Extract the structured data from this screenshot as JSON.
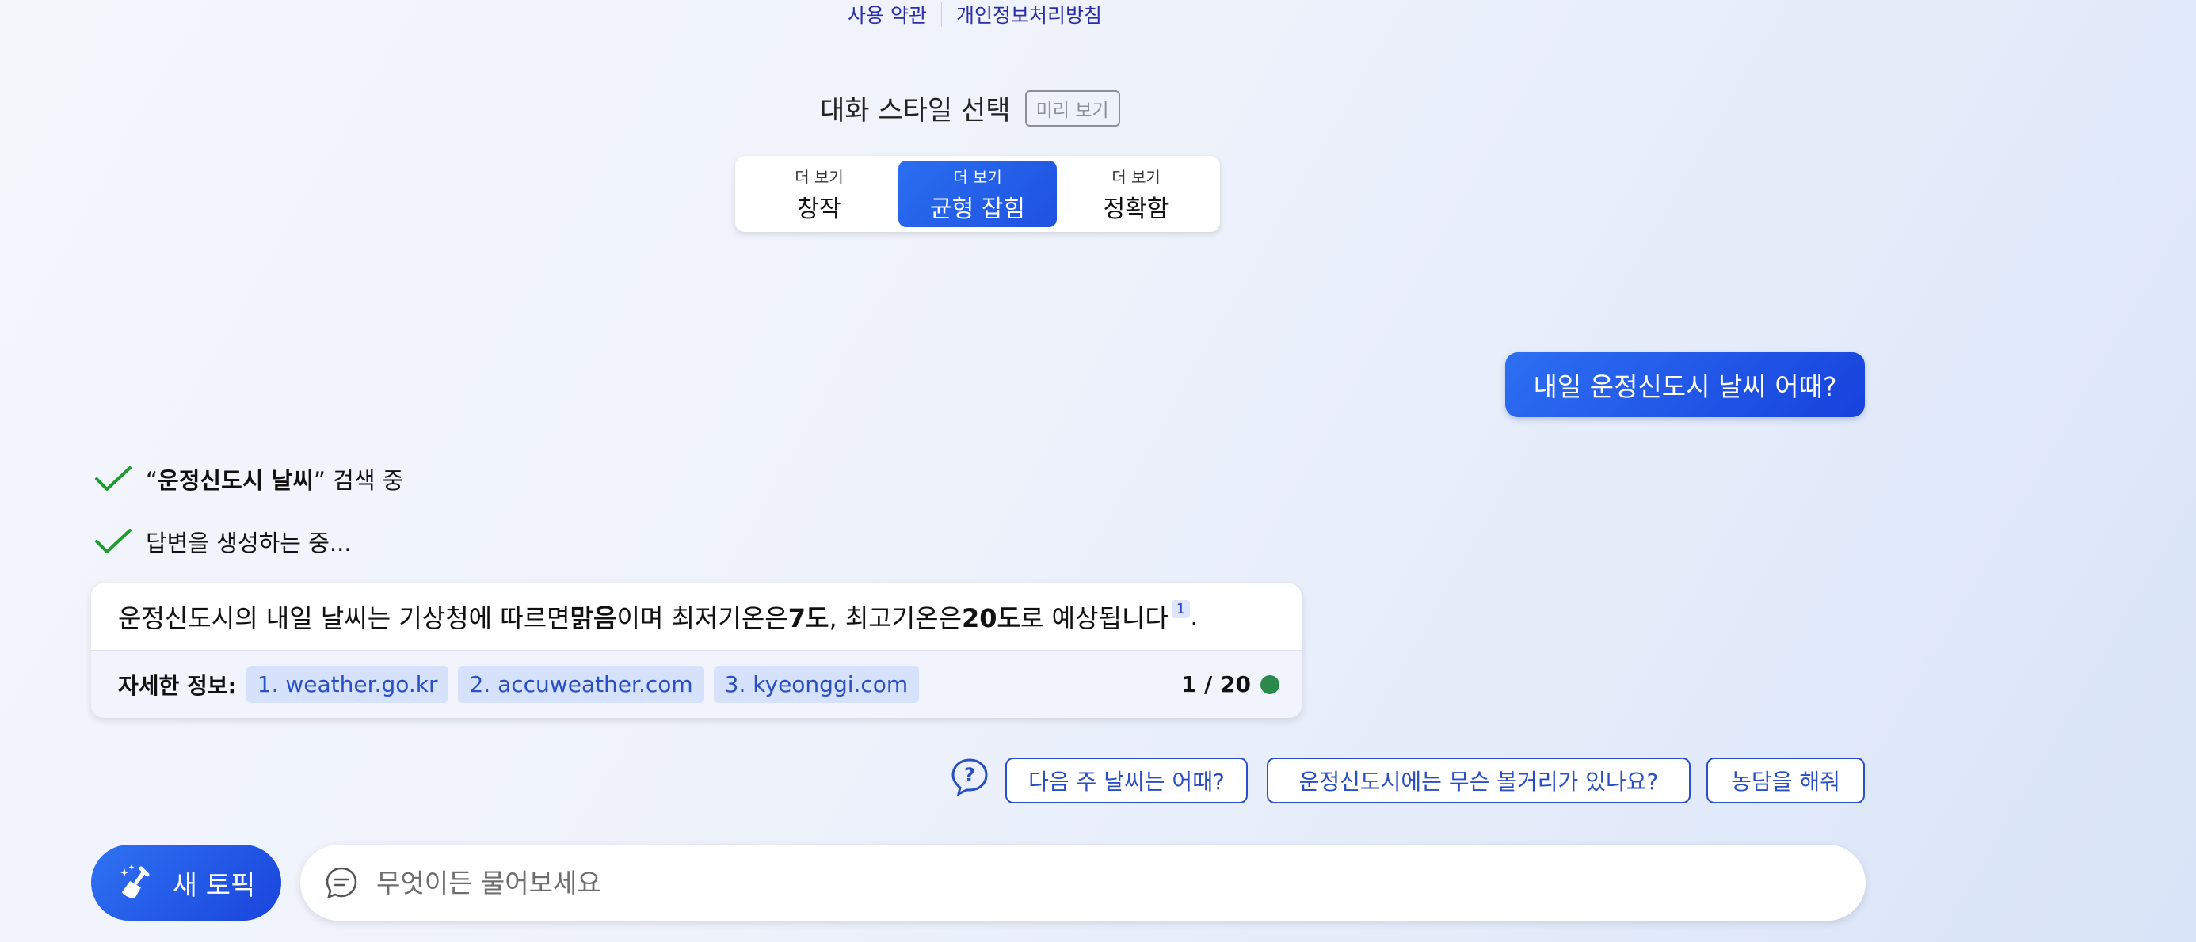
{
  "top_links": {
    "terms": "사용 약관",
    "privacy": "개인정보처리방침"
  },
  "style": {
    "title": "대화 스타일 선택",
    "preview_badge": "미리 보기",
    "options": [
      {
        "small": "더 보기",
        "label": "창작",
        "active": false
      },
      {
        "small": "더 보기",
        "label": "균형 잡힘",
        "active": true
      },
      {
        "small": "더 보기",
        "label": "정확함",
        "active": false
      }
    ]
  },
  "user_message": "내일 운정신도시 날씨 어때?",
  "progress": {
    "search_open_quote": "“",
    "search_query": "운정신도시 날씨",
    "search_close_quote": "”",
    "search_suffix": " 검색 중",
    "generating": "답변을 생성하는 중..."
  },
  "answer": {
    "p1": "운정신도시의 내일 날씨는 기상청에 따르면 ",
    "b1": "맑음",
    "p2": "이며 최저기온은 ",
    "b2": "7도",
    "p3": ", 최고기온은 ",
    "b3": "20도",
    "p4": "로 예상됩니다",
    "citation": "1",
    "end": ".",
    "sources_label": "자세한 정보:",
    "sources": [
      "1. weather.go.kr",
      "2. accuweather.com",
      "3. kyeonggi.com"
    ],
    "count": "1 / 20",
    "status_color": "#2b8a4b"
  },
  "suggestions": [
    "다음 주 날씨는 어때?",
    "운정신도시에는 무슨 볼거리가 있나요?",
    "농담을 해줘"
  ],
  "new_topic_label": "새 토픽",
  "input": {
    "placeholder": "무엇이든 물어보세요",
    "value": ""
  },
  "icons": {
    "help": "question-bubble-icon",
    "new_topic": "broom-sparkle-icon",
    "input": "chat-lines-icon",
    "check": "check-icon"
  },
  "colors": {
    "accent": "#1f52e0",
    "link": "#2a4fc4",
    "check": "#1e9c2e"
  }
}
